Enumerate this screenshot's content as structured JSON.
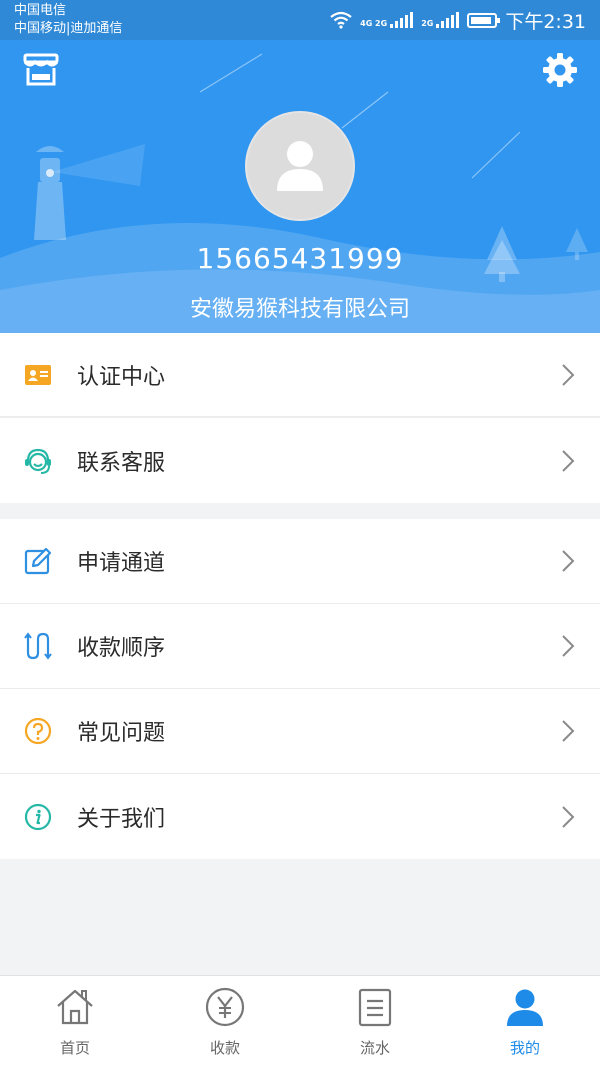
{
  "status_bar": {
    "carrier_1": "中国电信",
    "carrier_2": "中国移动|迪加通信",
    "signal_1_label": "4G 2G",
    "signal_2_label": "2G",
    "time": "下午2:31"
  },
  "header": {
    "shop_icon": "store-icon",
    "settings_icon": "gear-icon",
    "avatar_icon": "user-avatar-icon",
    "phone": "15665431999",
    "company": "安徽易猴科技有限公司"
  },
  "menu": {
    "group1": [
      {
        "label": "认证中心",
        "icon": "id-card-icon",
        "color": "#f5a623"
      },
      {
        "label": "联系客服",
        "icon": "customer-service-icon",
        "color": "#26b8a6"
      }
    ],
    "group2": [
      {
        "label": "申请通道",
        "icon": "edit-icon",
        "color": "#2f8fe0"
      },
      {
        "label": "收款顺序",
        "icon": "order-icon",
        "color": "#2f8fe0"
      },
      {
        "label": "常见问题",
        "icon": "question-icon",
        "color": "#f5a623"
      },
      {
        "label": "关于我们",
        "icon": "info-icon",
        "color": "#26b8a6"
      }
    ]
  },
  "tabbar": {
    "items": [
      {
        "label": "首页",
        "icon": "home-icon"
      },
      {
        "label": "收款",
        "icon": "yuan-icon"
      },
      {
        "label": "流水",
        "icon": "list-icon"
      },
      {
        "label": "我的",
        "icon": "user-icon",
        "active": true
      }
    ],
    "active_color": "#1e8be8"
  },
  "colors": {
    "brand_blue": "#3096f0",
    "status_bar": "#2f89d6"
  }
}
